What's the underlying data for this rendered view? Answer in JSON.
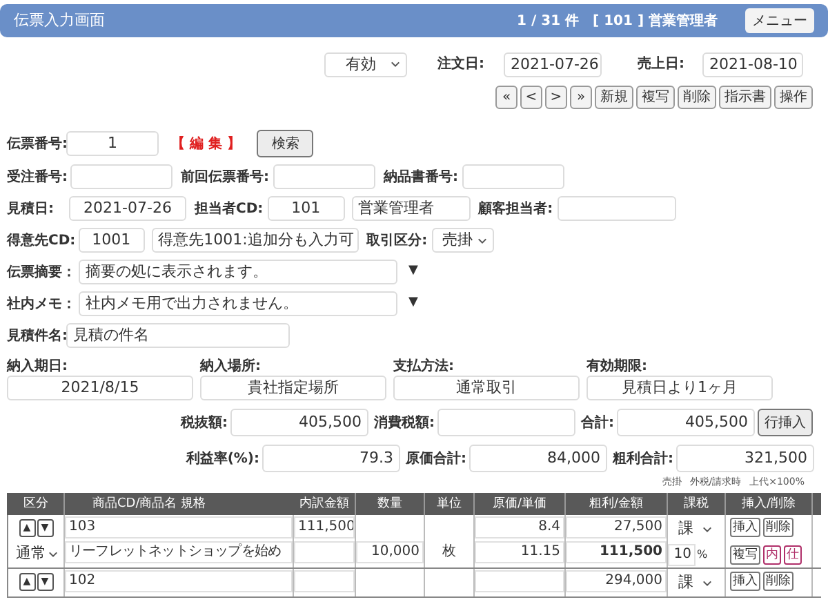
{
  "header": {
    "title": "伝票入力画面",
    "record_count": "1 / 31 件",
    "user": "[ 101 ] 営業管理者",
    "menu_button": "メニュー"
  },
  "toolbar": {
    "status": "有効",
    "order_date_label": "注文日:",
    "order_date": "2021-07-26",
    "sales_date_label": "売上日:",
    "sales_date": "2021-08-10"
  },
  "nav_buttons": [
    "«",
    "<",
    ">",
    "»",
    "新規",
    "複写",
    "削除",
    "指示書",
    "操作"
  ],
  "slip": {
    "label": "伝票番号:",
    "value": "1",
    "mode": "【 編 集 】",
    "search_button": "検索"
  },
  "field_rows": [
    [
      {
        "label": "受注番号:",
        "kind": "input"
      },
      {
        "label": "前回伝票番号:",
        "kind": "input"
      },
      {
        "label": "納品書番号:",
        "kind": "input"
      }
    ],
    [
      {
        "label": "見積日:",
        "value": "2021-07-26",
        "kind": "input"
      },
      {
        "label": "担当者CD:",
        "value": "101",
        "kind": "input"
      },
      {
        "value": "営業管理者",
        "kind": "input"
      },
      {
        "label": "顧客担当者:",
        "kind": "input"
      }
    ],
    [
      {
        "label": "得意先CD:",
        "value": "1001",
        "kind": "input"
      },
      {
        "value": "得意先1001:追加分も入力可",
        "kind": "input"
      },
      {
        "label": "取引区分:",
        "value": "売掛",
        "kind": "select"
      }
    ]
  ],
  "memos": [
    {
      "label": "伝票摘要：",
      "value": "摘要の処に表示されます。",
      "expand": "▼"
    },
    {
      "label": "社内メモ：",
      "value": "社内メモ用で出力されません。",
      "expand": "▼"
    }
  ],
  "subject": {
    "label": "見積件名:",
    "value": "見積の件名"
  },
  "delivery": [
    {
      "label": "納入期日:",
      "value": "2021/8/15"
    },
    {
      "label": "納入場所:",
      "value": "貴社指定場所"
    },
    {
      "label": "支払方法:",
      "value": "通常取引"
    },
    {
      "label": "有効期限:",
      "value": "見積日より1ヶ月"
    }
  ],
  "totals_rows": [
    [
      {
        "label": "税抜額:",
        "value": "405,500"
      },
      {
        "label": "消費税額:"
      },
      {
        "label": "合計:",
        "value": "405,500"
      }
    ],
    [
      {
        "label": "利益率(%):",
        "value": "79.3"
      },
      {
        "label": "原価合計:",
        "value": "84,000"
      },
      {
        "label": "粗利合計:",
        "value": "321,500"
      }
    ]
  ],
  "insert_row_button": "行挿入",
  "notes": [
    "売掛",
    "外税/請求時",
    "上代×100%"
  ],
  "table": {
    "columns": [
      "区分",
      "商品CD/商品名 規格",
      "内訳金額",
      "数量",
      "単位",
      "原価/単価",
      "粗利/金額",
      "課税",
      "挿入/削除"
    ],
    "rows": [
      {
        "up": "▲",
        "down": "▼",
        "category": "通常",
        "code": "103",
        "name": "リーフレットネットショップを始め",
        "breakdown": "111,500",
        "qty": "10,000",
        "unit": "枚",
        "cost": "8.4",
        "price": "11.15",
        "profit": "27,500",
        "amount": "111,500",
        "tax": "課",
        "tax_rate": "10",
        "tax_unit": "%",
        "buttons": [
          {
            "label": "挿入",
            "kind": "plain"
          },
          {
            "label": "削除",
            "kind": "plain"
          },
          {
            "label": "複写",
            "kind": "plain"
          },
          {
            "label": "内",
            "kind": "tag"
          },
          {
            "label": "仕",
            "kind": "tag"
          }
        ]
      },
      {
        "up": "▲",
        "down": "▼",
        "code": "102",
        "profit": "294,000",
        "tax": "課",
        "buttons": [
          {
            "label": "挿入",
            "kind": "plain"
          },
          {
            "label": "削除",
            "kind": "plain"
          }
        ]
      }
    ]
  }
}
